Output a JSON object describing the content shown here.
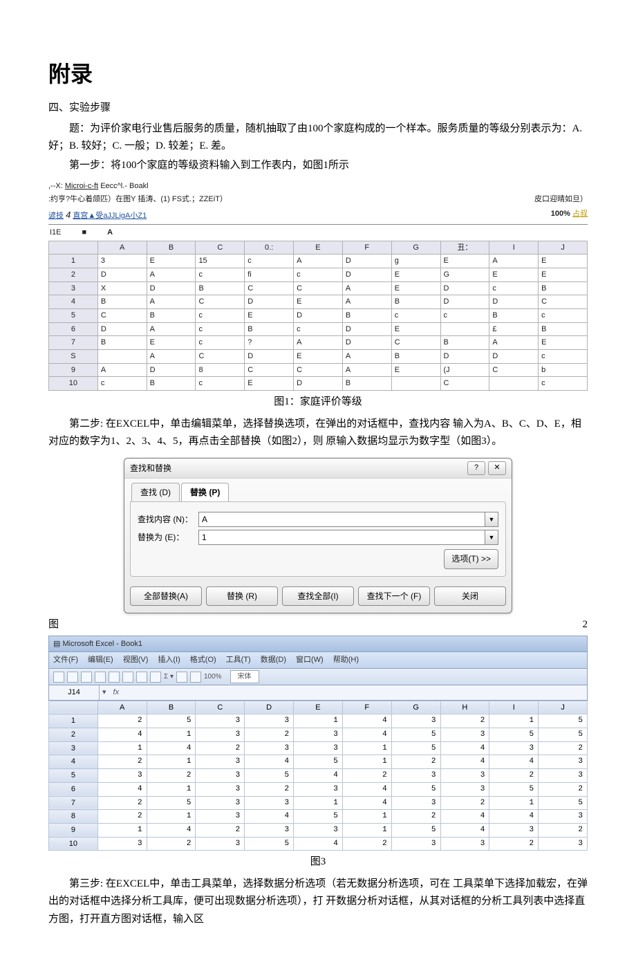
{
  "heading": "附录",
  "section4": "四、实验步骤",
  "para_topic": "题：为评价家电行业售后服务的质量，随机抽取了由100个家庭构成的一个样本。服务质量的等级分别表示为：A. 好；B. 较好；C. 一般；D. 较差；E. 差。",
  "para_step1": "第一步：将100个家庭的等级资料输入到工作表内，如图1所示",
  "fig1": {
    "line1_left": ",--X:",
    "line1_mid": "Microi-c-ft",
    "line1_right": "Eecc^l.- Boakl",
    "line2": ":约亨?牛心着颌匹）在图Y 插涛、(1) FS式.；ZZEiT）",
    "line2_right": "皮口迎晴如旦）",
    "line3_left": "谚技",
    "line3_num": "4",
    "line3_mid": "直宫▲受aJJLigA小Z1",
    "line3_zoom": "100%",
    "line3_right": "占叔",
    "namebox": "I1E",
    "name_fx_blk": "■",
    "name_fx": "A",
    "cols": [
      "",
      "A",
      "B",
      "C",
      "0.:",
      "E",
      "F",
      "G",
      "丑：",
      "I",
      "J"
    ],
    "rows": [
      [
        "1",
        "3",
        "E",
        "15",
        "c",
        "A",
        "D",
        "g",
        "E",
        "A",
        "E"
      ],
      [
        "2",
        "D",
        "A",
        "c",
        "fi",
        "c",
        "D",
        "E",
        "G",
        "E",
        "E"
      ],
      [
        "3",
        "X",
        "D",
        "B",
        "C",
        "C",
        "A",
        "E",
        "D",
        "c",
        "B"
      ],
      [
        "4",
        "B",
        "A",
        "C",
        "D",
        "E",
        "A",
        "B",
        "D",
        "D",
        "C"
      ],
      [
        "5",
        "C",
        "B",
        "c",
        "E",
        "D",
        "B",
        "c",
        "c",
        "B",
        "c"
      ],
      [
        "6",
        "D",
        "A",
        "c",
        "B",
        "c",
        "D",
        "E",
        "",
        "£",
        "B"
      ],
      [
        "7",
        "B",
        "E",
        "c",
        "?",
        "A",
        "D",
        "C",
        "B",
        "A",
        "E"
      ],
      [
        "S",
        "",
        "A",
        "C",
        "D",
        "E",
        "A",
        "B",
        "D",
        "D",
        "c"
      ],
      [
        "9",
        "A",
        "D",
        "8",
        "C",
        "C",
        "A",
        "E",
        "(J",
        "C",
        "b"
      ],
      [
        "10",
        "c",
        "B",
        "c",
        "E",
        "D",
        "B",
        "",
        "C",
        "",
        "c"
      ]
    ],
    "caption": "图1：家庭评价等级"
  },
  "para_step2": "第二步: 在EXCEL中，单击编辑菜单，选择替换选项，在弹出的对话框中，查找内容 输入为A、B、C、D、E，相对应的数字为1、2、3、4、5，再点击全部替换（如图2），则 原输入数据均显示为数字型（如图3）。",
  "fig2": {
    "title": "查找和替换",
    "help_icon": "?",
    "close_icon": "✕",
    "tab_find": "查找 (D)",
    "tab_replace": "替换 (P)",
    "lbl_find": "查找内容 (N)：",
    "val_find": "A",
    "lbl_replace": "替换为 (E)：",
    "val_replace": "1",
    "btn_options": "选项(T) >>",
    "btn_replace_all": "全部替换(A)",
    "btn_replace": "替换 (R)",
    "btn_find_all": "查找全部(I)",
    "btn_find_next": "查找下一个 (F)",
    "btn_close": "关闭",
    "split_left": "图",
    "split_right": "2"
  },
  "fig3": {
    "apptitle": "Microsoft Excel - Book1",
    "menus": [
      "文件(F)",
      "编辑(E)",
      "视图(V)",
      "插入(I)",
      "格式(O)",
      "工具(T)",
      "数据(D)",
      "窗口(W)",
      "帮助(H)"
    ],
    "zoom": "100%",
    "font": "宋体",
    "cellref": "J14",
    "fx": "fx",
    "cols": [
      "",
      "A",
      "B",
      "C",
      "D",
      "E",
      "F",
      "G",
      "H",
      "I",
      "J"
    ],
    "rows": [
      [
        "1",
        2,
        5,
        3,
        3,
        1,
        4,
        3,
        2,
        1,
        5
      ],
      [
        "2",
        4,
        1,
        3,
        2,
        3,
        4,
        5,
        3,
        5,
        5
      ],
      [
        "3",
        1,
        4,
        2,
        3,
        3,
        1,
        5,
        4,
        3,
        2
      ],
      [
        "4",
        2,
        1,
        3,
        4,
        5,
        1,
        2,
        4,
        4,
        3
      ],
      [
        "5",
        3,
        2,
        3,
        5,
        4,
        2,
        3,
        3,
        2,
        3
      ],
      [
        "6",
        4,
        1,
        3,
        2,
        3,
        4,
        5,
        3,
        5,
        2
      ],
      [
        "7",
        2,
        5,
        3,
        3,
        1,
        4,
        3,
        2,
        1,
        5
      ],
      [
        "8",
        2,
        1,
        3,
        4,
        5,
        1,
        2,
        4,
        4,
        3
      ],
      [
        "9",
        1,
        4,
        2,
        3,
        3,
        1,
        5,
        4,
        3,
        2
      ],
      [
        "10",
        3,
        2,
        3,
        5,
        4,
        2,
        3,
        3,
        2,
        3
      ]
    ],
    "caption": "图3"
  },
  "para_step3": "第三步: 在EXCEL中，单击工具菜单，选择数据分析选项（若无数据分析选项，可在 工具菜单下选择加载宏，在弹出的对话框中选择分析工具库，便可出现数据分析选项），打 开数据分析对话框，从其对话框的分析工具列表中选择直方图，打开直方图对话框，输入区"
}
